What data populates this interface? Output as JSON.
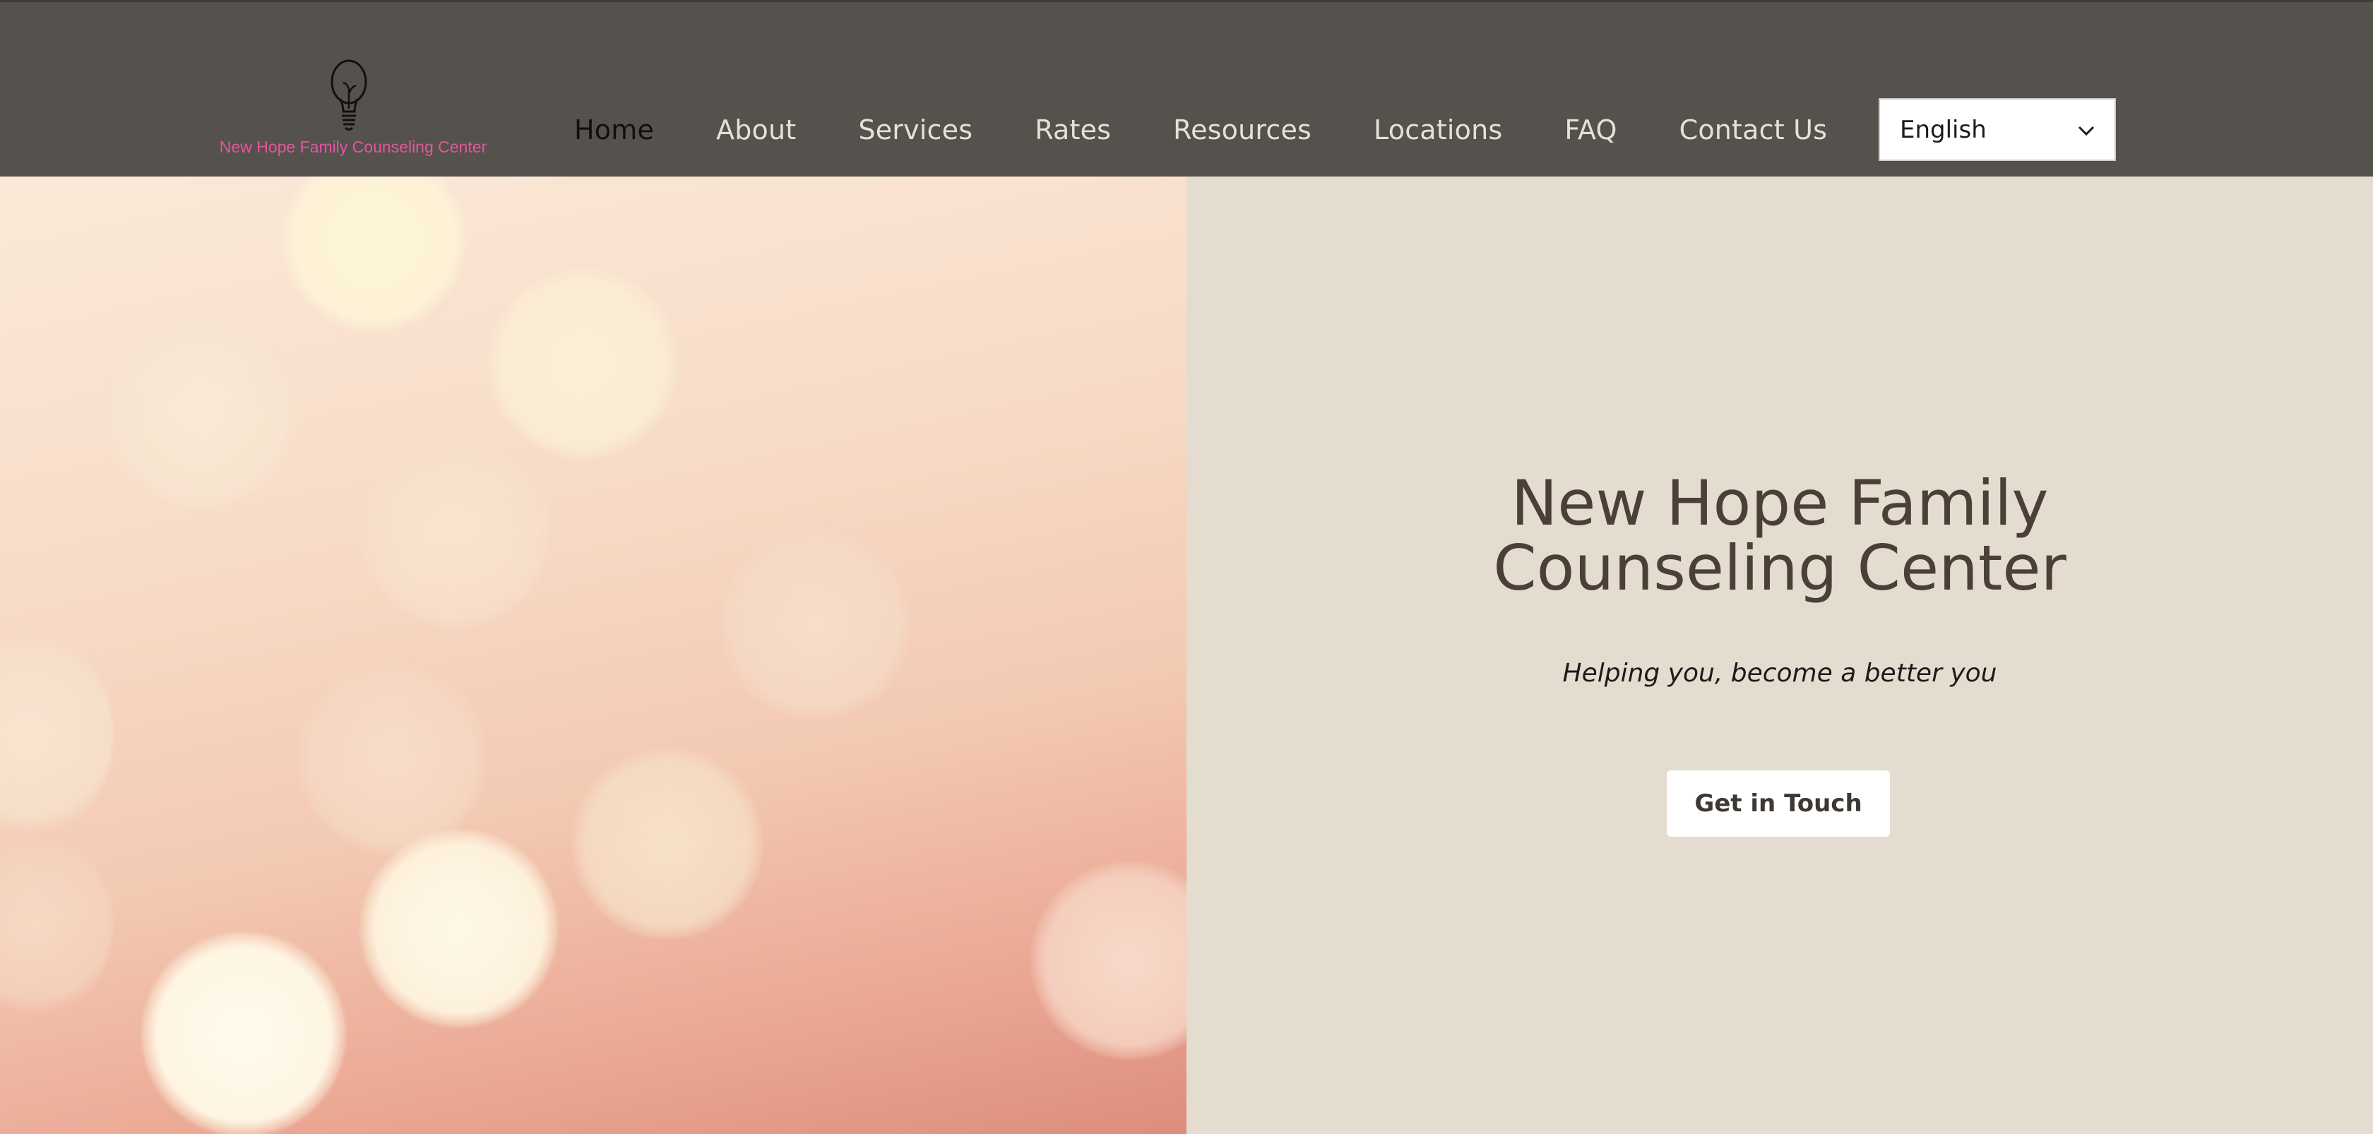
{
  "header": {
    "logo": {
      "icon": "lightbulb-icon",
      "text": "New Hope Family Counseling Center",
      "text_color": "#e5559f"
    },
    "nav": [
      {
        "label": "Home",
        "active": true
      },
      {
        "label": "About",
        "active": false
      },
      {
        "label": "Services",
        "active": false
      },
      {
        "label": "Rates",
        "active": false
      },
      {
        "label": "Resources",
        "active": false
      },
      {
        "label": "Locations",
        "active": false
      },
      {
        "label": "FAQ",
        "active": false
      },
      {
        "label": "Contact Us",
        "active": false
      }
    ],
    "language_select": {
      "value": "English",
      "icon": "chevron-down-icon"
    },
    "background_color": "#55514c"
  },
  "hero": {
    "title_line1": "New Hope Family",
    "title_line2": "Counseling Center",
    "subtitle": "Helping you, become a better you",
    "cta_label": "Get in Touch",
    "panel_color": "#e5dcd0",
    "title_color": "#4a4038"
  }
}
